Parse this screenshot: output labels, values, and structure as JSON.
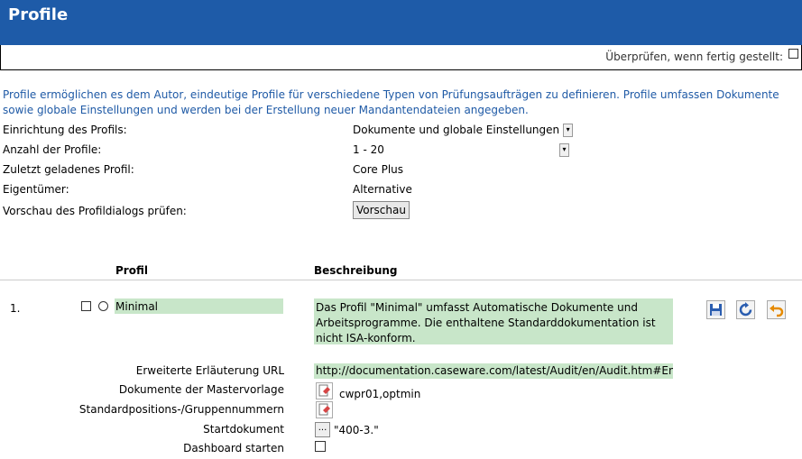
{
  "header": {
    "title": "Profile"
  },
  "subbar": {
    "check_label": "Überprüfen, wenn fertig gestellt:"
  },
  "intro": "Profile ermöglichen es dem Autor, eindeutige Profile für verschiedene Typen von Prüfungsaufträgen zu definieren. Profile umfassen Dokumente sowie globale Einstellungen und werden bei der Erstellung neuer Mandantendateien angegeben.",
  "fields": {
    "setup_label": "Einrichtung des Profils:",
    "setup_value": "Dokumente und globale Einstellungen",
    "count_label": "Anzahl der Profile:",
    "count_value": "1 - 20",
    "last_label": "Zuletzt geladenes Profil:",
    "last_value": "Core Plus",
    "owner_label": "Eigentümer:",
    "owner_value": "Alternative",
    "preview_label": "Vorschau des Profildialogs prüfen:",
    "preview_button": "Vorschau"
  },
  "table": {
    "col_profile": "Profil",
    "col_description": "Beschreibung",
    "row": {
      "number": "1.",
      "name": "Minimal",
      "description": "Das Profil \"Minimal\" umfasst Automatische Dokumente und Arbeitsprogramme. Die enthaltene Standarddokumentation ist nicht ISA-konform.",
      "url_label": "Erweiterte Erläuterung URL",
      "url_value": "http://documentation.caseware.com/latest/Audit/en/Audit.htm#Engag",
      "master_label": "Dokumente der Mastervorlage",
      "master_value": "cwpr01,optmin",
      "positions_label": "Standardpositions-/Gruppennummern",
      "start_label": "Startdokument",
      "start_button": "...",
      "start_value": "\"400-3.\"",
      "dashboard_label": "Dashboard starten"
    }
  },
  "colors": {
    "header_bg": "#1e5ba8",
    "intro_text": "#1f5aa6",
    "highlight": "#c8e6c9"
  }
}
